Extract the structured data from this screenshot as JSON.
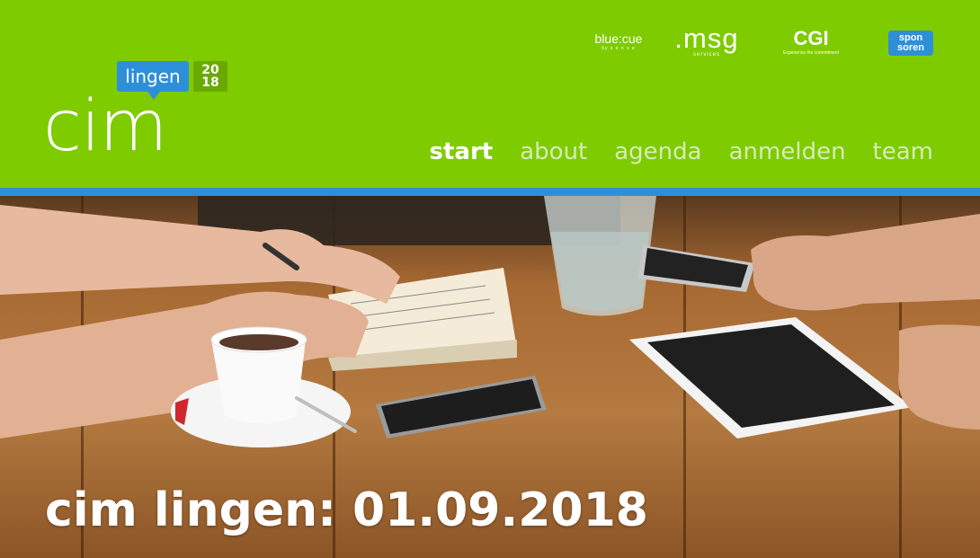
{
  "logo": {
    "main": "cim",
    "bubble": "lingen",
    "year_top": "20",
    "year_bottom": "18"
  },
  "sponsors": {
    "bluecue": {
      "main": "blue:cue",
      "sub": "by s e n s e"
    },
    "msg": {
      "main": ".msg",
      "sub": "services"
    },
    "cgi": {
      "main": "CGI",
      "sub": "Experience the commitment"
    },
    "sponsoren": {
      "line1": "spon",
      "line2": "soren"
    }
  },
  "nav": {
    "items": [
      {
        "label": "start",
        "active": true
      },
      {
        "label": "about",
        "active": false
      },
      {
        "label": "agenda",
        "active": false
      },
      {
        "label": "anmelden",
        "active": false
      },
      {
        "label": "team",
        "active": false
      }
    ]
  },
  "hero": {
    "title": "cim lingen: 01.09.2018"
  },
  "colors": {
    "header_green": "#7ecb00",
    "accent_blue": "#2e8fd9",
    "nav_inactive": "#d7ecb8",
    "white": "#ffffff"
  }
}
